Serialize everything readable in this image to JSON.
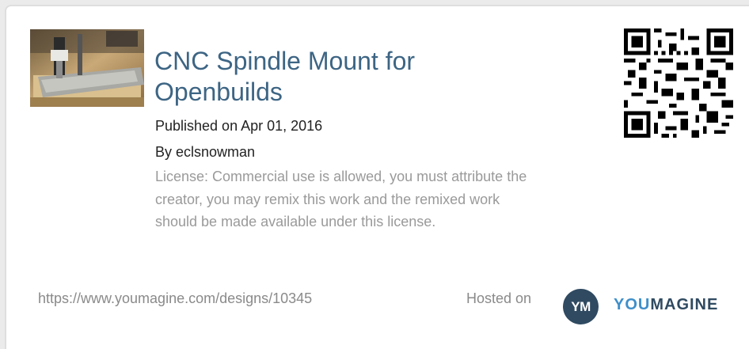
{
  "design": {
    "title": "CNC Spindle Mount for Openbuilds",
    "published": "Published on Apr 01, 2016",
    "author": "By eclsnowman",
    "license": "License: Commercial use is allowed, you must attribute the creator, you may remix this work and the remixed work should be made available under this license."
  },
  "footer": {
    "url": "https://www.youmagine.com/designs/10345",
    "hosted_label": "Hosted on",
    "logo_badge": "YM",
    "logo_you": "YOU",
    "logo_magine": "MAGINE"
  },
  "colors": {
    "title": "#3d6584",
    "muted": "#9a9a9a",
    "brand_dark": "#2f4a61",
    "brand_light": "#3f8fca"
  },
  "icons": {
    "thumbnail": "cnc-machine-photo",
    "qr": "qr-code-icon"
  }
}
